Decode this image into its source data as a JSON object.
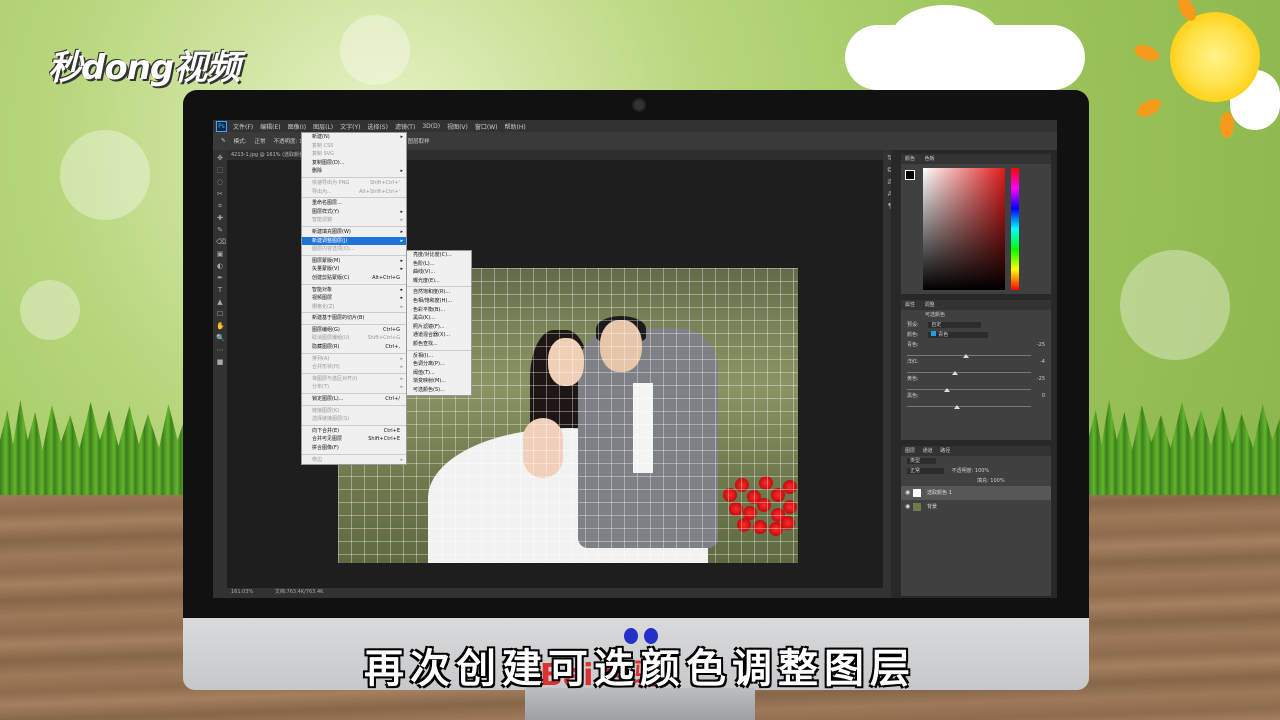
{
  "logo": {
    "text": "秒dong视频"
  },
  "subtitle": "再次创建可选颜色调整图层",
  "watermark": "Bai 经验",
  "photoshop": {
    "menubar": [
      "文件(F)",
      "编辑(E)",
      "图像(I)",
      "图层(L)",
      "文字(Y)",
      "选择(S)",
      "滤镜(T)",
      "3D(D)",
      "视图(V)",
      "窗口(W)",
      "帮助(H)"
    ],
    "options": [
      "模式:",
      "正常",
      "不透明度: 100%",
      "流量: 100%",
      "自动抹除",
      "对所有图层取样"
    ],
    "doc_tab": "4213-1.jpg @ 161% (选取颜色 1, 图层蒙版/8)",
    "status": {
      "zoom": "161.03%",
      "doc": "文档:763.4K/763.4K"
    },
    "layer_menu": [
      {
        "label": "新建(N)",
        "sub": true
      },
      {
        "label": "复制 CSS",
        "dis": true
      },
      {
        "label": "复制 SVG",
        "dis": true
      },
      {
        "label": "复制图层(D)..."
      },
      {
        "label": "删除",
        "sub": true
      },
      {
        "sep": true
      },
      {
        "label": "快速导出为 PNG",
        "shortcut": "Shift+Ctrl+'",
        "dis": true
      },
      {
        "label": "导出为...",
        "shortcut": "Alt+Shift+Ctrl+'",
        "dis": true
      },
      {
        "sep": true
      },
      {
        "label": "重命名图层..."
      },
      {
        "label": "图层样式(Y)",
        "sub": true
      },
      {
        "label": "智能滤镜",
        "sub": true,
        "dis": true
      },
      {
        "sep": true
      },
      {
        "label": "新建填充图层(W)",
        "sub": true
      },
      {
        "label": "新建调整图层(J)",
        "sub": true,
        "hl": true
      },
      {
        "label": "图层内容选项(O)...",
        "dis": true
      },
      {
        "sep": true
      },
      {
        "label": "图层蒙版(M)",
        "sub": true
      },
      {
        "label": "矢量蒙版(V)",
        "sub": true
      },
      {
        "label": "创建剪贴蒙版(C)",
        "shortcut": "Alt+Ctrl+G"
      },
      {
        "sep": true
      },
      {
        "label": "智能对象",
        "sub": true
      },
      {
        "label": "视频图层",
        "sub": true
      },
      {
        "label": "栅格化(Z)",
        "sub": true,
        "dis": true
      },
      {
        "sep": true
      },
      {
        "label": "新建基于图层的切片(B)"
      },
      {
        "sep": true
      },
      {
        "label": "图层编组(G)",
        "shortcut": "Ctrl+G"
      },
      {
        "label": "取消图层编组(U)",
        "shortcut": "Shift+Ctrl+G",
        "dis": true
      },
      {
        "label": "隐藏图层(R)",
        "shortcut": "Ctrl+,"
      },
      {
        "sep": true
      },
      {
        "label": "排列(A)",
        "sub": true,
        "dis": true
      },
      {
        "label": "合并形状(H)",
        "sub": true,
        "dis": true
      },
      {
        "sep": true
      },
      {
        "label": "将图层与选区对齐(I)",
        "sub": true,
        "dis": true
      },
      {
        "label": "分布(T)",
        "sub": true,
        "dis": true
      },
      {
        "sep": true
      },
      {
        "label": "锁定图层(L)...",
        "shortcut": "Ctrl+/"
      },
      {
        "sep": true
      },
      {
        "label": "链接图层(K)",
        "dis": true
      },
      {
        "label": "选择链接图层(S)",
        "dis": true
      },
      {
        "sep": true
      },
      {
        "label": "向下合并(E)",
        "shortcut": "Ctrl+E"
      },
      {
        "label": "合并可见图层",
        "shortcut": "Shift+Ctrl+E"
      },
      {
        "label": "拼合图像(F)"
      },
      {
        "sep": true
      },
      {
        "label": "修边",
        "sub": true,
        "dis": true
      }
    ],
    "adjust_submenu": [
      "亮度/对比度(C)...",
      "色阶(L)...",
      "曲线(V)...",
      "曝光度(E)...",
      "-",
      "自然饱和度(R)...",
      "色相/饱和度(H)...",
      "色彩平衡(B)...",
      "黑白(K)...",
      "照片滤镜(F)...",
      "通道混合器(X)...",
      "颜色查找...",
      "-",
      "反相(I)...",
      "色调分离(P)...",
      "阈值(T)...",
      "渐变映射(M)...",
      "可选颜色(S)..."
    ],
    "color_panel": {
      "tabs": [
        "颜色",
        "色板"
      ]
    },
    "properties": {
      "tabs": [
        "属性",
        "调整"
      ],
      "title": "可选颜色",
      "preset_label": "预设:",
      "preset": "自定",
      "colors_label": "颜色:",
      "colors": "青色",
      "sliders": [
        {
          "label": "青色:",
          "value": "-25",
          "pos": 0.45
        },
        {
          "label": "洋红:",
          "value": "-4",
          "pos": 0.36
        },
        {
          "label": "黄色:",
          "value": "-25",
          "pos": 0.3
        },
        {
          "label": "黑色:",
          "value": "0",
          "pos": 0.38
        }
      ]
    },
    "layers": {
      "tabs": [
        "图层",
        "通道",
        "路径"
      ],
      "kind": "类型",
      "mode": "正常",
      "opacity": "不透明度: 100%",
      "fill": "填充: 100%",
      "items": [
        {
          "name": "选取颜色 1",
          "selected": true
        },
        {
          "name": "背景",
          "selected": false
        }
      ]
    }
  },
  "colors": {
    "accent": "#1e73d8",
    "bg": "#282828"
  }
}
